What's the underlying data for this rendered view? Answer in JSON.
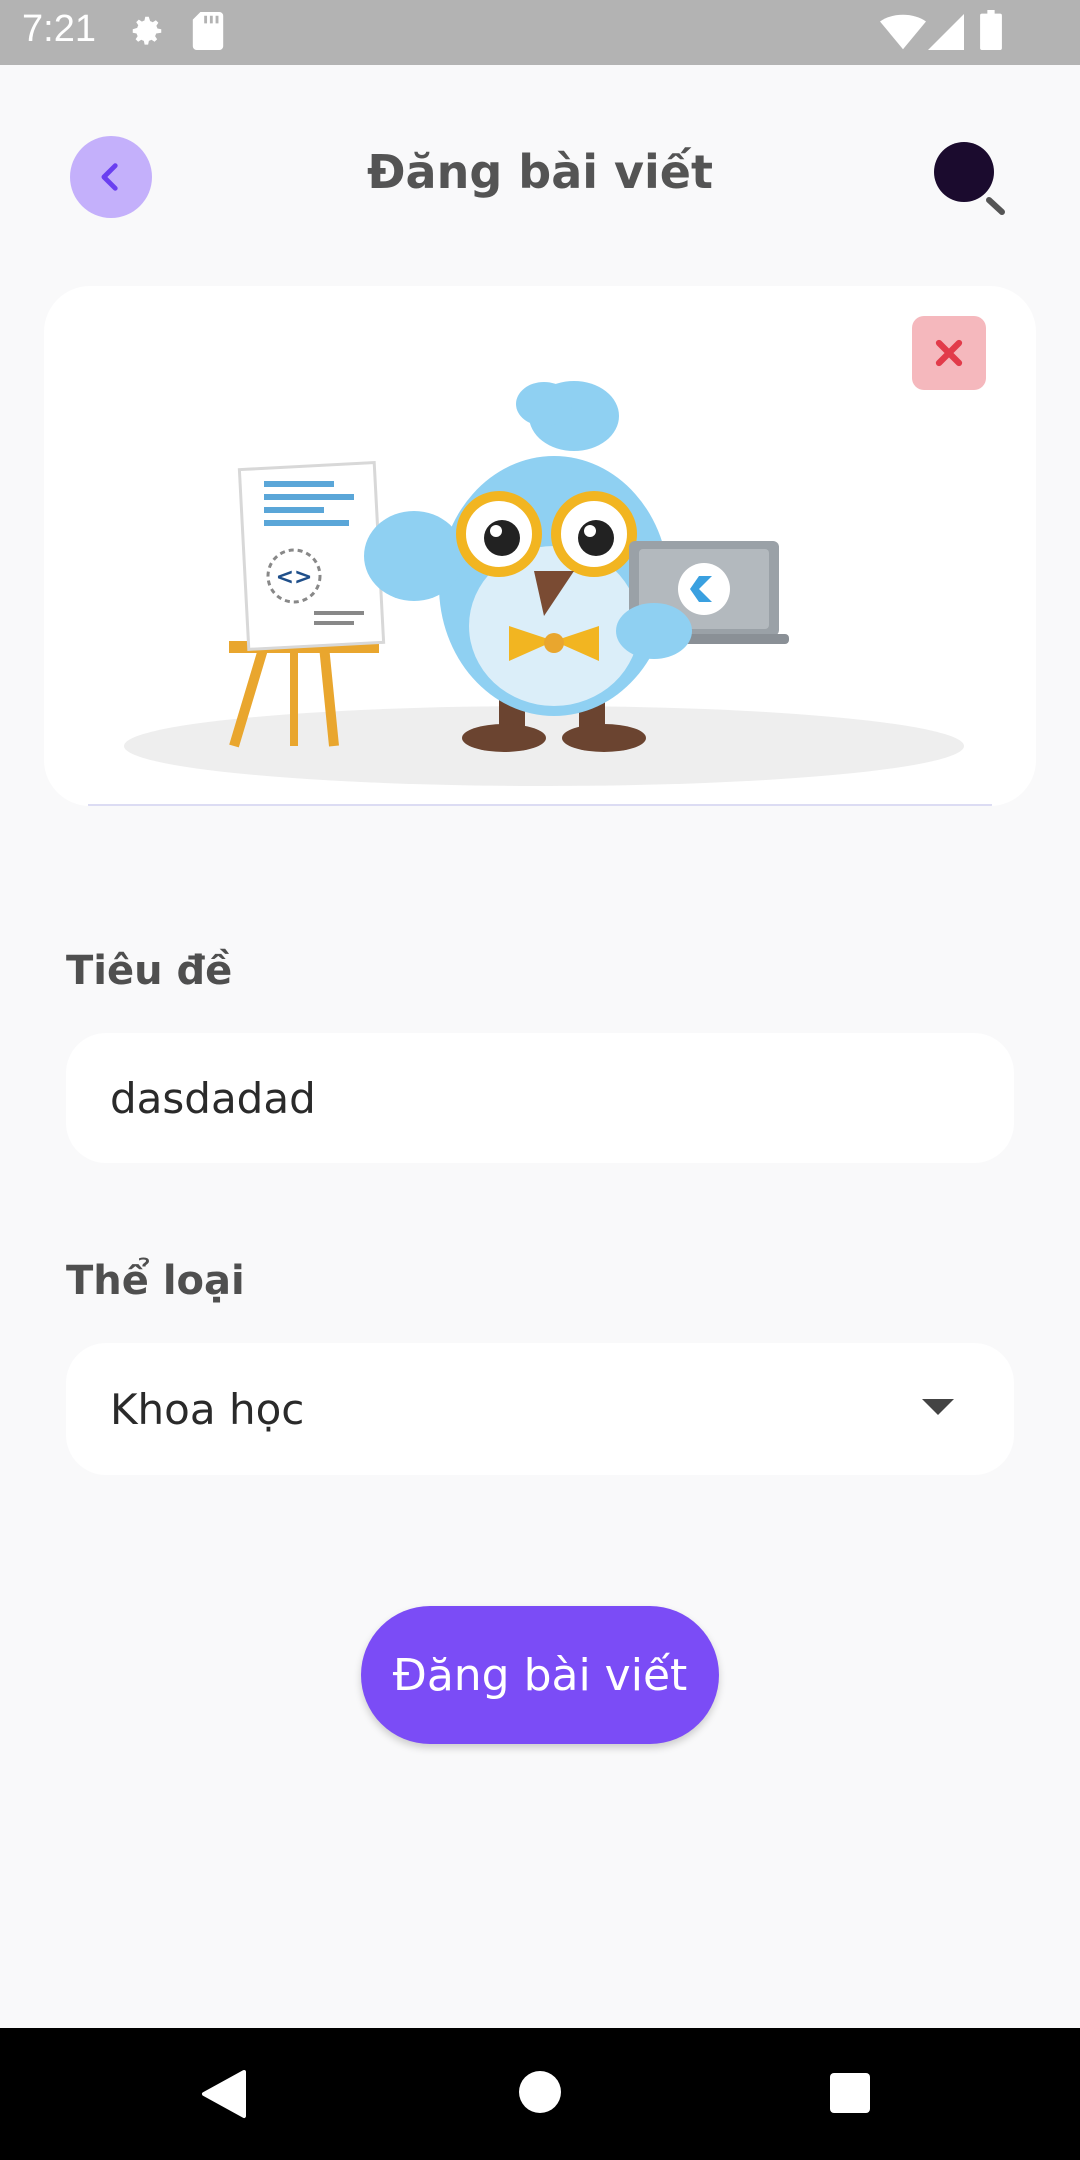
{
  "status_bar": {
    "time": "7:21",
    "icons": [
      "gear-icon",
      "sd-card-icon",
      "wifi-icon",
      "signal-icon",
      "battery-icon"
    ]
  },
  "header": {
    "title": "Đăng bài viết",
    "back_icon": "chevron-left-icon",
    "avatar_icon": "search-avatar-icon"
  },
  "image_card": {
    "remove_icon": "close-icon"
  },
  "form": {
    "title_label": "Tiêu đề",
    "title_value": "dasdadad",
    "category_label": "Thể loại",
    "category_value": "Khoa học"
  },
  "submit_label": "Đăng bài viết",
  "colors": {
    "accent": "#7b4cf6",
    "back_button_bg": "#c4b0fb",
    "remove_button_bg": "#f5b8bd",
    "remove_icon": "#e23b4a"
  },
  "nav_bar": {
    "buttons": [
      "back-triangle-icon",
      "home-circle-icon",
      "recents-square-icon"
    ]
  }
}
